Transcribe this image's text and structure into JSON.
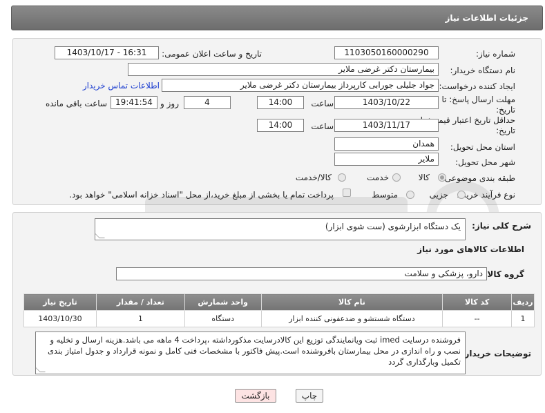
{
  "header": {
    "title": "جزئیات اطلاعات نیاز"
  },
  "form": {
    "need_number_label": "شماره نیاز:",
    "need_number": "1103050160000290",
    "announce_label": "تاریخ و ساعت اعلان عمومی:",
    "announce_value": "1403/10/17 - 16:31",
    "buyer_label": "نام دستگاه خریدار:",
    "buyer_value": "بیمارستان دکتر غرضی ملایر",
    "creator_label": "ایجاد کننده درخواست:",
    "creator_value": "جواد جلیلی جورابی کارپرداز بیمارستان دکتر غرضی ملایر",
    "contact_link": "اطلاعات تماس خریدار",
    "reply_deadline_label_1": "مهلت ارسال پاسخ: تا",
    "reply_deadline_label_2": "تاریخ:",
    "reply_date": "1403/10/22",
    "time_label": "ساعت",
    "reply_time": "14:00",
    "days_value": "4",
    "days_label": "روز و",
    "remaining_time": "19:41:54",
    "remaining_label": "ساعت باقی مانده",
    "validity_label_1": "حداقل تاریخ اعتبار قیمت: تا",
    "validity_label_2": "تاریخ:",
    "validity_date": "1403/11/17",
    "validity_time": "14:00",
    "province_label": "استان محل تحویل:",
    "province_value": "همدان",
    "city_label": "شهر محل تحویل:",
    "city_value": "ملایر",
    "category_label": "طبقه بندی موضوعی:",
    "category_options": [
      "کالا",
      "خدمت",
      "کالا/خدمت"
    ],
    "category_selected": "کالا",
    "process_label": "نوع فرآیند خرید :",
    "process_options": [
      "جزیی",
      "متوسط"
    ],
    "treasury_text": "پرداخت تمام یا بخشی از مبلغ خرید،از محل \"اسناد خزانه اسلامی\" خواهد بود."
  },
  "details": {
    "summary_label": "شرح کلی نیاز:",
    "summary_value": "یک دستگاه ابزارشوی (ست شوی ابزار)",
    "goods_info_title": "اطلاعات کالاهای مورد نیاز",
    "group_label": "گروه کالا:",
    "group_value": "دارو، پزشکی و سلامت",
    "table": {
      "headers": [
        "ردیف",
        "کد کالا",
        "نام کالا",
        "واحد شمارش",
        "تعداد / مقدار",
        "تاریخ نیاز"
      ],
      "rows": [
        [
          "1",
          "--",
          "دستگاه شستشو و ضدعفونی کننده ابزار",
          "دستگاه",
          "1",
          "1403/10/30"
        ]
      ]
    },
    "buyer_notes_label": "توضیحات خریدار:",
    "buyer_notes": "فروشنده درسایت imed ثبت ویانمایندگی توزیع این کالادرسایت مذکورداشته ،پرداخت 4 ماهه می باشد.هزینه ارسال و تخلیه و نصب و راه اندازی در محل بیمارستان بافروشنده است.پیش فاکتور با مشخصات فنی کامل و نمونه قرارداد و جدول امتیاز بندی تکمیل وبارگذاری گردد"
  },
  "buttons": {
    "print": "چاپ",
    "back": "بازگشت"
  },
  "colors": {
    "header_gray": "#7a7a7a",
    "link_blue": "#1a3ccf",
    "back_button": "#fde3e3"
  }
}
